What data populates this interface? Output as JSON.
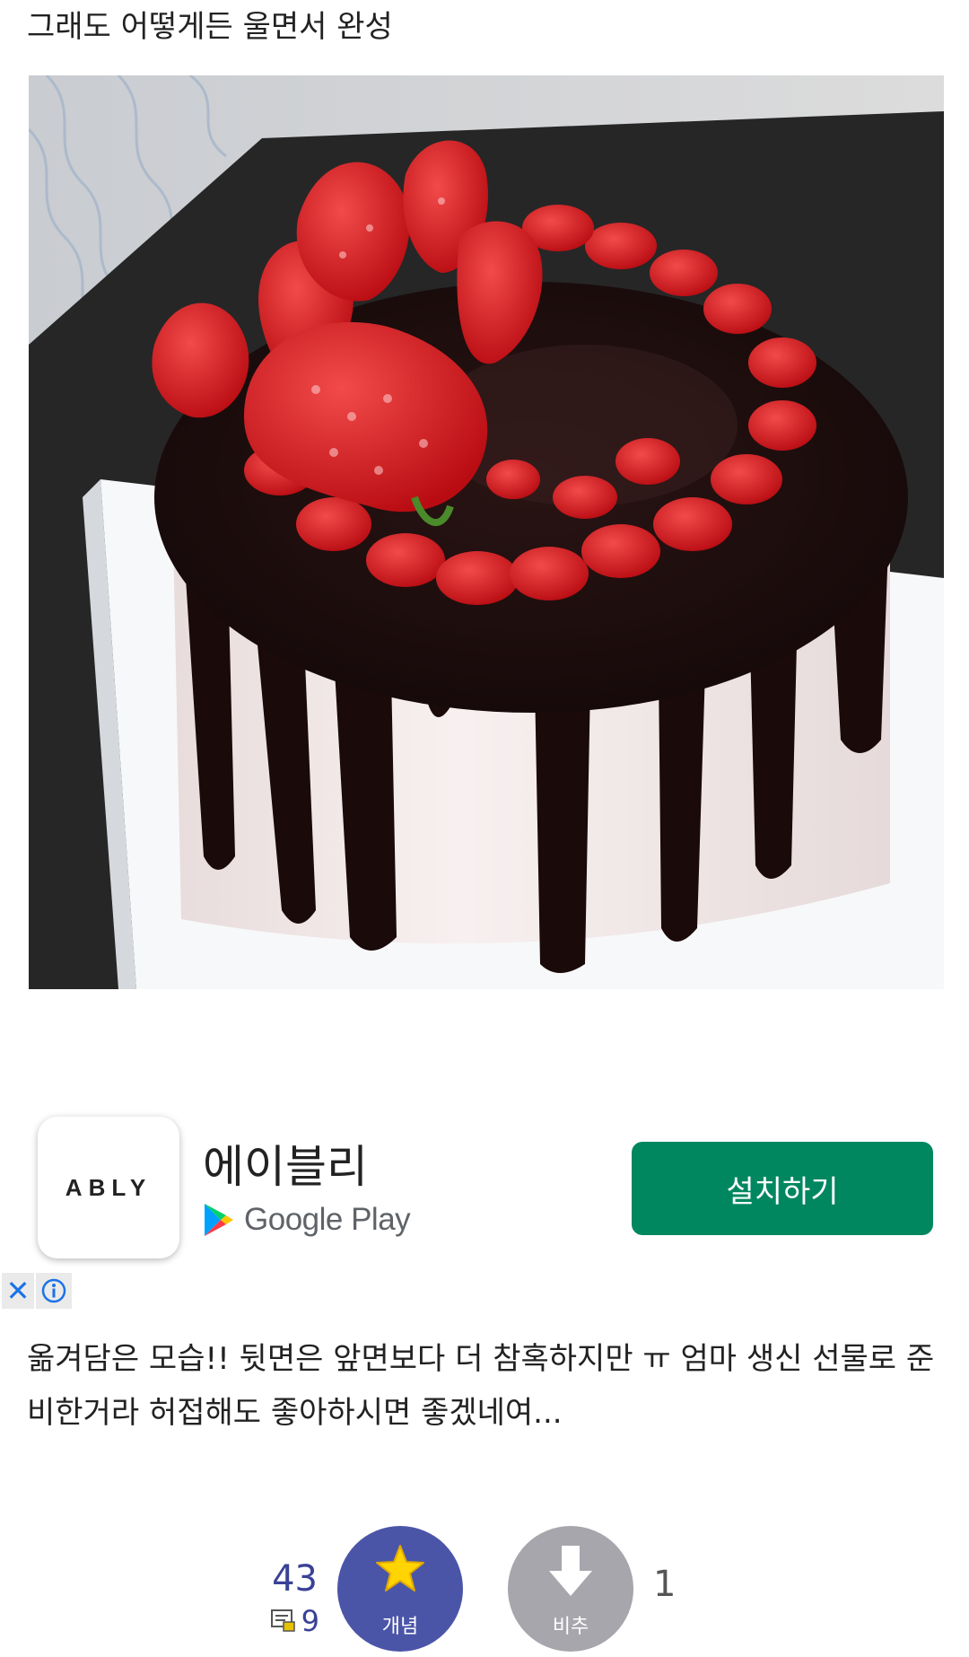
{
  "post": {
    "caption_top": "그래도 어떻게든 울면서 완성",
    "caption_body": "옮겨담은 모습!! 뒷면은 앞면보다 더 참혹하지만 ㅠ 엄마 생신 선물로 준비한거라 허접해도 좋아하시면 좋겠네여..."
  },
  "ad": {
    "app_icon_text": "ABLY",
    "app_name": "에이블리",
    "store_name": "Google Play",
    "install_label": "설치하기",
    "close_symbol": "✕",
    "icons": {
      "store": "google-play-icon",
      "close": "close-icon",
      "info": "info-icon"
    },
    "colors": {
      "install": "#01875f",
      "adchoices": "#1a73e8"
    }
  },
  "votes": {
    "up_count": "43",
    "comment_count": "9",
    "up_label": "개념",
    "down_label": "비추",
    "down_count": "1",
    "icons": {
      "up": "star-icon",
      "down": "down-arrow-icon",
      "comment": "comment-icon"
    },
    "colors": {
      "up": "#4b55a8",
      "down": "#a6a6ac",
      "star": "#ffd400"
    }
  }
}
